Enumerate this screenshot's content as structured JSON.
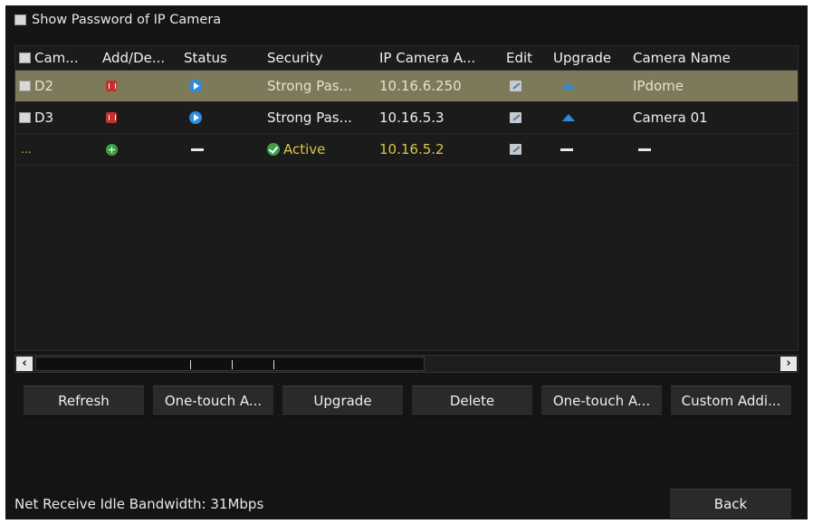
{
  "show_password": {
    "label": "Show Password of IP Camera",
    "checked": false
  },
  "table": {
    "columns": [
      "Cam...",
      "Add/De...",
      "Status",
      "Security",
      "IP Camera A...",
      "Edit",
      "Upgrade",
      "Camera Name"
    ],
    "rows": [
      {
        "camera": "D2",
        "security": "Strong Pas...",
        "ip": "10.16.6.250",
        "name": "IPdome",
        "selected": true
      },
      {
        "camera": "D3",
        "security": "Strong Pas...",
        "ip": "10.16.5.3",
        "name": "Camera 01",
        "selected": false
      },
      {
        "camera": "...",
        "security": "Active",
        "ip": "10.16.5.2",
        "name": "",
        "selected": false
      }
    ]
  },
  "buttons": {
    "refresh": "Refresh",
    "one_touch_activate": "One-touch A...",
    "upgrade": "Upgrade",
    "delete": "Delete",
    "one_touch_add": "One-touch A...",
    "custom_add": "Custom Addi...",
    "back": "Back"
  },
  "footer": {
    "bandwidth": "Net Receive Idle Bandwidth: 31Mbps"
  },
  "colors": {
    "background": "#141414",
    "selected_row": "#7d7a5c",
    "active_text": "#d9c643",
    "status_blue": "#2f8be0",
    "delete_red": "#c0322b",
    "add_green": "#3da046"
  }
}
